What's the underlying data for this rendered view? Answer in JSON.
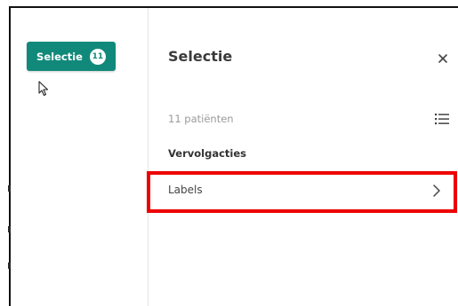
{
  "sidebar": {
    "selection_button": {
      "label": "Selectie",
      "count": "11"
    }
  },
  "panel": {
    "title": "Selectie",
    "close_icon": "close-icon",
    "patient_count": "11 patiënten",
    "list_icon": "list-icon",
    "follow_up_heading": "Vervolgacties",
    "rows": [
      {
        "label": "Labels",
        "icon": "chevron-right-icon"
      }
    ]
  },
  "colors": {
    "accent": "#11897a",
    "highlight": "#ee0000"
  }
}
